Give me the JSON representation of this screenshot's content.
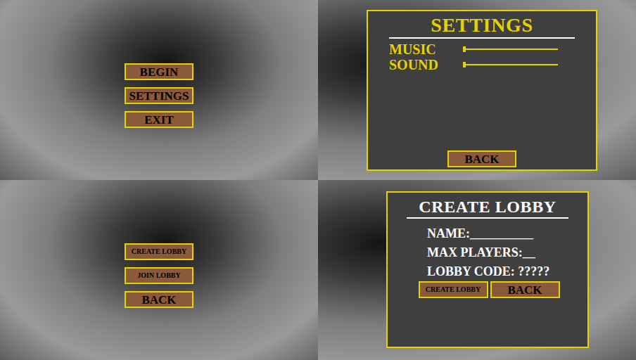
{
  "main_menu": {
    "buttons": [
      {
        "label": "BEGIN",
        "kind": "large"
      },
      {
        "label": "SETTINGS",
        "kind": "large"
      },
      {
        "label": "EXIT",
        "kind": "large"
      }
    ]
  },
  "settings": {
    "title": "SETTINGS",
    "sliders": [
      {
        "label": "MUSIC",
        "level": 0.02
      },
      {
        "label": "SOUND",
        "level": 0.02
      }
    ],
    "back": "BACK"
  },
  "lobby_menu": {
    "buttons": [
      {
        "label": "CREATE LOBBY",
        "kind": "small"
      },
      {
        "label": "JOIN LOBBY",
        "kind": "small"
      },
      {
        "label": "BACK",
        "kind": "large"
      }
    ]
  },
  "create_lobby": {
    "title": "CREATE LOBBY",
    "fields": [
      "NAME:__________",
      "MAX PLAYERS:__",
      "LOBBY CODE: ?????"
    ],
    "buttons": [
      {
        "label": "CREATE LOBBY",
        "kind": "small"
      },
      {
        "label": "BACK",
        "kind": "large"
      }
    ]
  }
}
